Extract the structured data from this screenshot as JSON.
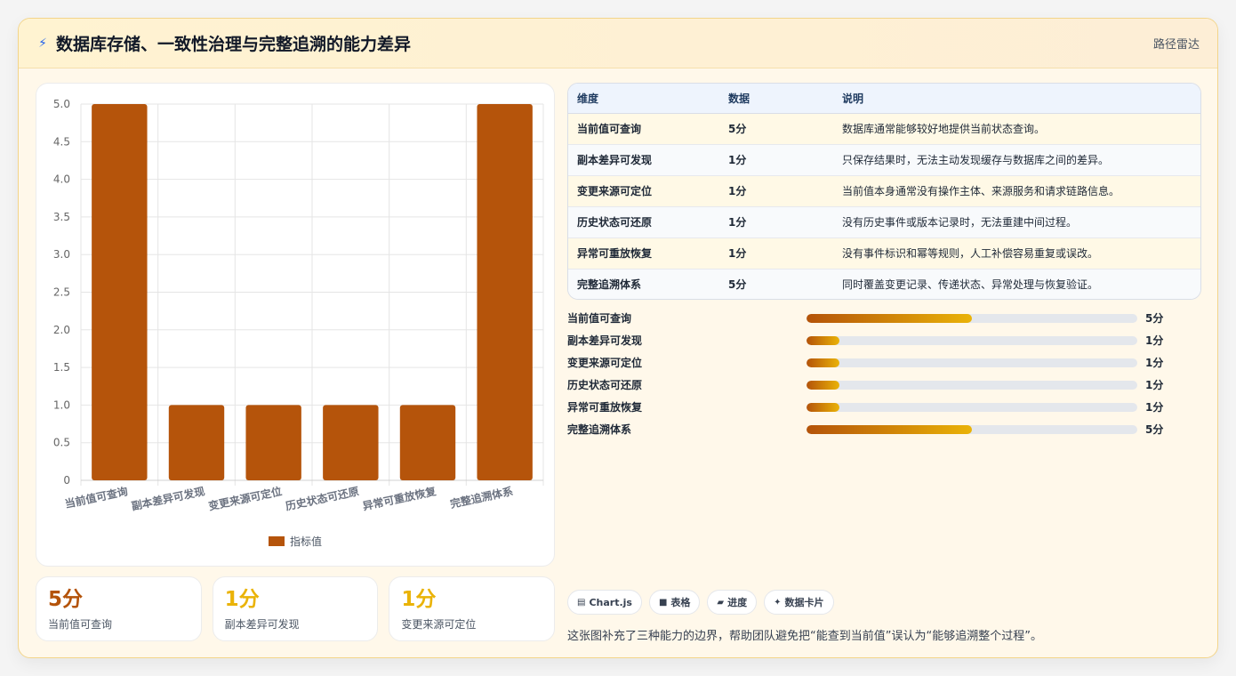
{
  "header": {
    "icon": "lightning-icon",
    "title": "数据库存储、一致性治理与完整追溯的能力差异",
    "link_label": "路径雷达"
  },
  "chart_data": {
    "type": "bar",
    "categories": [
      "当前值可查询",
      "副本差异可发现",
      "变更来源可定位",
      "历史状态可还原",
      "异常可重放恢复",
      "完整追溯体系"
    ],
    "series": [
      {
        "name": "指标值",
        "values": [
          5,
          1,
          1,
          1,
          1,
          5
        ]
      }
    ],
    "ylim": [
      0,
      5
    ],
    "yticks": [
      "0",
      "0.5",
      "1.0",
      "1.5",
      "2.0",
      "2.5",
      "3.0",
      "3.5",
      "4.0",
      "4.5",
      "5.0"
    ],
    "grid": true,
    "legend": "bottom",
    "bar_color": "#b5540b"
  },
  "stats": [
    {
      "value": "5分",
      "label": "当前值可查询",
      "color": "#b45309"
    },
    {
      "value": "1分",
      "label": "副本差异可发现",
      "color": "#eab308"
    },
    {
      "value": "1分",
      "label": "变更来源可定位",
      "color": "#eab308"
    }
  ],
  "table": {
    "headers": [
      "维度",
      "数据",
      "说明"
    ],
    "rows": [
      [
        "当前值可查询",
        "5分",
        "数据库通常能够较好地提供当前状态查询。"
      ],
      [
        "副本差异可发现",
        "1分",
        "只保存结果时，无法主动发现缓存与数据库之间的差异。"
      ],
      [
        "变更来源可定位",
        "1分",
        "当前值本身通常没有操作主体、来源服务和请求链路信息。"
      ],
      [
        "历史状态可还原",
        "1分",
        "没有历史事件或版本记录时，无法重建中间过程。"
      ],
      [
        "异常可重放恢复",
        "1分",
        "没有事件标识和幂等规则，人工补偿容易重复或误改。"
      ],
      [
        "完整追溯体系",
        "5分",
        "同时覆盖变更记录、传递状态、异常处理与恢复验证。"
      ]
    ]
  },
  "progress": {
    "max": 10,
    "items": [
      {
        "label": "当前值可查询",
        "value": 5,
        "display": "5分"
      },
      {
        "label": "副本差异可发现",
        "value": 1,
        "display": "1分"
      },
      {
        "label": "变更来源可定位",
        "value": 1,
        "display": "1分"
      },
      {
        "label": "历史状态可还原",
        "value": 1,
        "display": "1分"
      },
      {
        "label": "异常可重放恢复",
        "value": 1,
        "display": "1分"
      },
      {
        "label": "完整追溯体系",
        "value": 5,
        "display": "5分"
      }
    ]
  },
  "chips": [
    {
      "icon": "chart-icon",
      "glyph": "▤",
      "label": "Chart.js"
    },
    {
      "icon": "table-icon",
      "glyph": "■",
      "label": "表格"
    },
    {
      "icon": "progress-icon",
      "glyph": "▰",
      "label": "进度"
    },
    {
      "icon": "card-icon",
      "glyph": "✦",
      "label": "数据卡片"
    }
  ],
  "footnote": "这张图补充了三种能力的边界，帮助团队避免把“能查到当前值”误认为“能够追溯整个过程”。"
}
